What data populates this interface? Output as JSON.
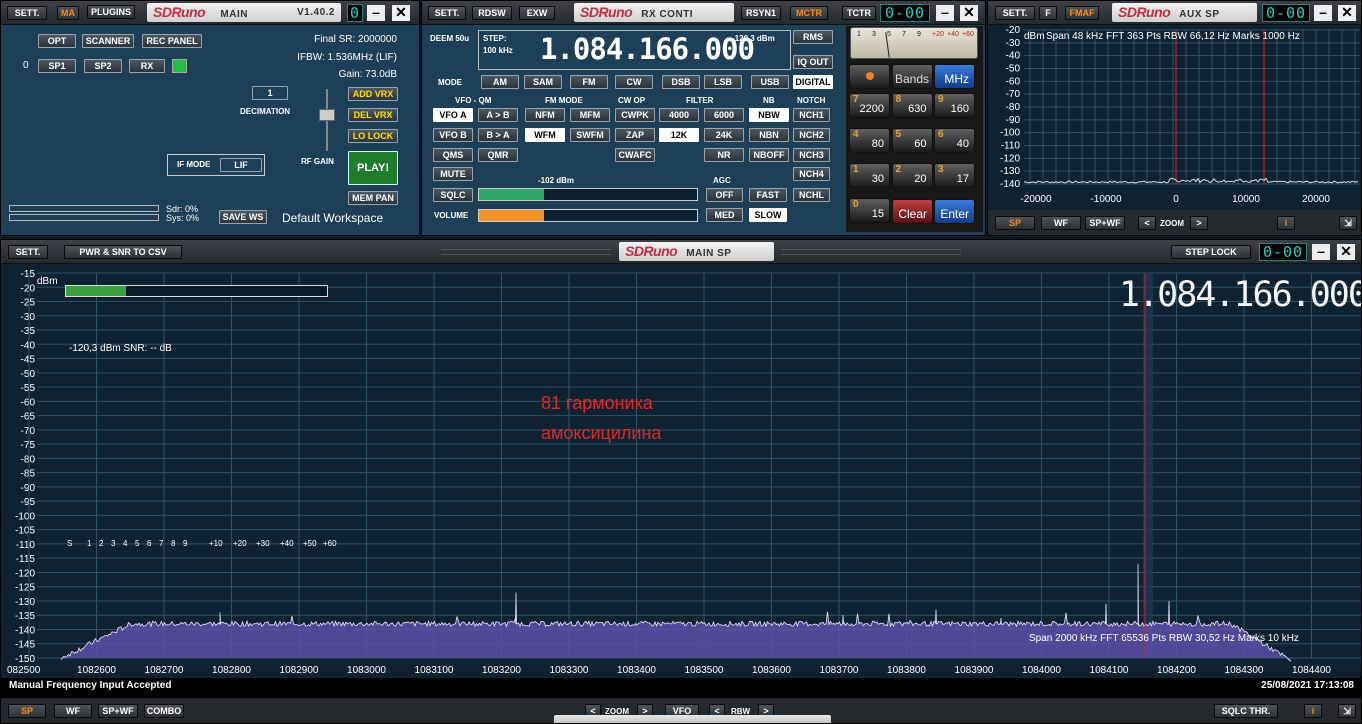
{
  "main_window": {
    "sett": "SETT.",
    "ma": "MA",
    "plugins": "PLUGINS",
    "logo": "SDRuno",
    "title": "MAIN",
    "version": "V1.40.2",
    "seg": "0",
    "buttons": [
      "OPT",
      "SCANNER",
      "REC PANEL"
    ],
    "sp_index": "0",
    "sp_buttons": [
      "SP1",
      "SP2",
      "RX"
    ],
    "final_sr": "Final SR: 2000000",
    "ifbw": "IFBW: 1.536MHz (LIF)",
    "gain": "Gain: 73.0dB",
    "decimation_value": "1",
    "decimation_label": "DECIMATION",
    "vrx": [
      "ADD VRX",
      "DEL VRX",
      "LO LOCK"
    ],
    "rf_gain": "RF GAIN",
    "play": "PLAY!",
    "mem_pan": "MEM PAN",
    "if_mode_label": "IF MODE",
    "if_mode_value": "LIF",
    "sdr": "Sdr: 0%",
    "sys": "Sys: 0%",
    "save_ws": "SAVE WS",
    "workspace": "Default Workspace"
  },
  "rx_window": {
    "sett": "SETT.",
    "rdsw": "RDSW",
    "exw": "EXW",
    "logo": "SDRuno",
    "title": "RX CONTI",
    "rsyn1": "RSYN1",
    "mctr": "MCTR",
    "tctr": "TCTR",
    "seg": "0-00",
    "deem": "DEEM 50u",
    "step_label": "STEP:",
    "step_value": "100 kHz",
    "frequency": "1.084.166.000",
    "dbm": "-120,3 dBm",
    "rms": "RMS",
    "iq_out": "IQ OUT",
    "mode_label": "MODE",
    "modes": [
      "AM",
      "SAM",
      "FM",
      "CW",
      "DSB",
      "LSB",
      "USB",
      "DIGITAL"
    ],
    "vfo_qm": "VFO - QM",
    "fm_mode": "FM MODE",
    "cw_op": "CW OP",
    "filter": "FILTER",
    "nb": "NB",
    "notch": "NOTCH",
    "r1": [
      "VFO A",
      "A > B",
      "NFM",
      "MFM",
      "CWPK",
      "4000",
      "6000",
      "NBW",
      "NCH1"
    ],
    "r2": [
      "VFO B",
      "B > A",
      "WFM",
      "SWFM",
      "ZAP",
      "12K",
      "24K",
      "NBN",
      "NCH2"
    ],
    "r3": [
      "QMS",
      "QMR",
      "CWAFC",
      "NR",
      "NBOFF",
      "NCH3"
    ],
    "mute": "MUTE",
    "nch4": "NCH4",
    "agc": "AGC",
    "sqlc": "SQLC",
    "sq_dbm": "-102 dBm",
    "off": "OFF",
    "fast": "FAST",
    "nchl": "NCHL",
    "volume": "VOLUME",
    "med": "MED",
    "slow": "SLOW",
    "sql_level": 0.3,
    "volume_level": 0.3,
    "meter": [
      "1",
      "3",
      "5",
      "7",
      "9",
      "+20",
      "+40",
      "+60"
    ],
    "keypad": {
      "bands": "Bands",
      "mhz": "MHz",
      "clear": "Clear",
      "enter": "Enter",
      "keys": [
        {
          "n": "7",
          "v": "2200"
        },
        {
          "n": "8",
          "v": "630"
        },
        {
          "n": "9",
          "v": "160"
        },
        {
          "n": "4",
          "v": "80"
        },
        {
          "n": "5",
          "v": "60"
        },
        {
          "n": "6",
          "v": "40"
        },
        {
          "n": "1",
          "v": "30"
        },
        {
          "n": "2",
          "v": "20"
        },
        {
          "n": "3",
          "v": "17"
        },
        {
          "n": "0",
          "v": "15"
        }
      ]
    }
  },
  "aux_window": {
    "sett": "SETT.",
    "f": "F",
    "fmaf": "FMAF",
    "logo": "SDRuno",
    "title": "AUX SP",
    "seg": "0-00",
    "dbm": "dBm",
    "info": "Span 48 kHz   FFT 363 Pts   RBW 66,12 Hz   Marks 1000 Hz",
    "yticks": [
      "-20",
      "-30",
      "-40",
      "-50",
      "-60",
      "-70",
      "-80",
      "-90",
      "-100",
      "-110",
      "-120",
      "-130",
      "-140"
    ],
    "xticks": [
      "-20000",
      "-10000",
      "0",
      "10000",
      "20000"
    ],
    "buttons": {
      "sp": "SP",
      "wf": "WF",
      "spwf": "SP+WF",
      "zoom": "ZOOM",
      "lt": "<",
      "gt": ">",
      "i": "i",
      "resize": "⇲"
    }
  },
  "main_sp": {
    "sett": "SETT.",
    "pwr": "PWR & SNR TO CSV",
    "logo": "SDRuno",
    "title": "MAIN SP",
    "step_lock": "STEP LOCK",
    "seg": "0-00",
    "dbm": "dBm",
    "meter_scale": [
      "S",
      "1",
      "2",
      "3",
      "4",
      "5",
      "6",
      "7",
      "8",
      "9",
      "+10",
      "+20",
      "+30",
      "+40",
      "+50",
      "+60"
    ],
    "meter_level": 0.23,
    "level": "-120,3 dBm   SNR: -- dB",
    "frequency": "1.084.166.000",
    "annotation_1": "81 гармоника",
    "annotation_2": "амоксицилина",
    "yticks": [
      "-15",
      "-20",
      "-25",
      "-30",
      "-35",
      "-40",
      "-45",
      "-50",
      "-55",
      "-60",
      "-65",
      "-70",
      "-75",
      "-80",
      "-85",
      "-90",
      "-95",
      "-100",
      "-105",
      "-110",
      "-115",
      "-120",
      "-125",
      "-130",
      "-135",
      "-140",
      "-145",
      "-150"
    ],
    "xticks": [
      "082500",
      "1082600",
      "1082700",
      "1082800",
      "1082900",
      "1083000",
      "1083100",
      "1083200",
      "1083300",
      "1083400",
      "1083500",
      "1083600",
      "1083700",
      "1083800",
      "1083900",
      "1084000",
      "1084100",
      "1084200",
      "1084300",
      "1084400"
    ],
    "info": "Span 2000 kHz   FFT 65536 Pts   RBW 30,52 Hz   Marks 10 kHz",
    "status": "Manual Frequency Input Accepted",
    "datetime": "25/08/2021 17:13:08",
    "bottom": {
      "sp": "SP",
      "wf": "WF",
      "spwf": "SP+WF",
      "combo": "COMBO",
      "zoom": "ZOOM",
      "vfo": "VFO",
      "rbw": "RBW",
      "sqlc": "SQLC THR.",
      "i": "i",
      "lt": "<",
      "gt": ">"
    },
    "colors": {
      "fill": "#5b4fa8",
      "trace": "#e8e6ff",
      "marker": "#d02020",
      "grid": "#2e5068"
    }
  }
}
